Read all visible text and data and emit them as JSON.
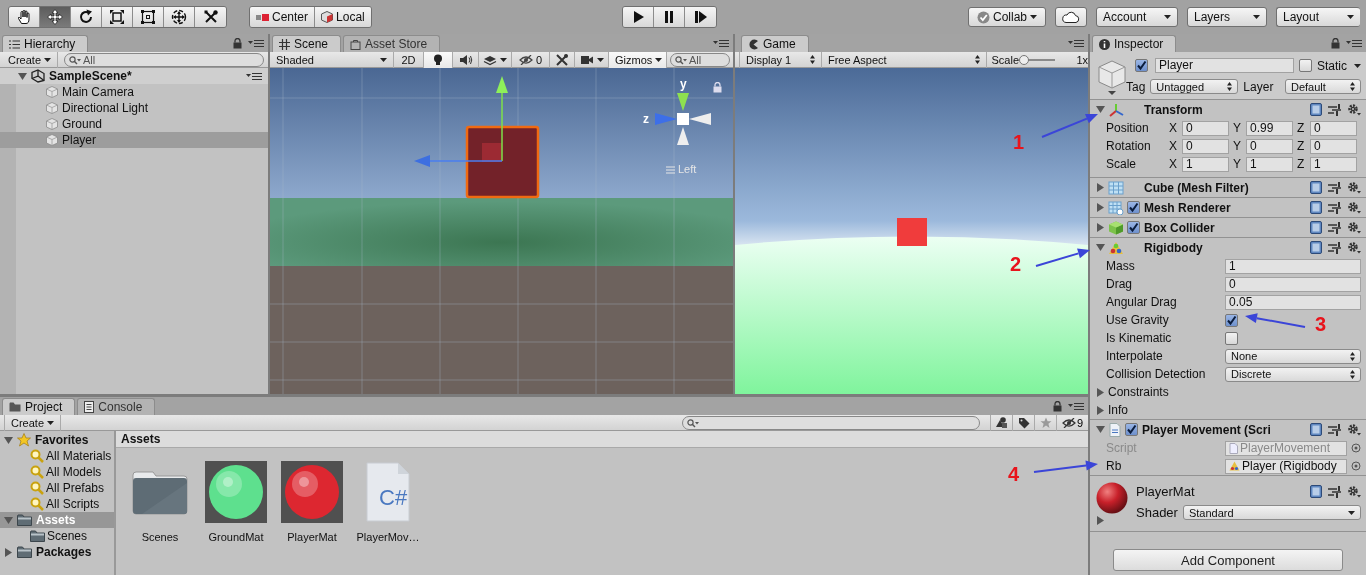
{
  "toolbar": {
    "tools": [
      {
        "kind": "hand",
        "selected": false
      },
      {
        "kind": "move",
        "selected": true
      },
      {
        "kind": "rotate",
        "selected": false
      },
      {
        "kind": "scale",
        "selected": false
      },
      {
        "kind": "rect",
        "selected": false
      },
      {
        "kind": "transform",
        "selected": false
      },
      {
        "kind": "custom",
        "selected": false
      }
    ],
    "pivot": [
      {
        "kind": "center",
        "label": "Center"
      },
      {
        "kind": "local",
        "label": "Local"
      }
    ],
    "playback": [
      {
        "kind": "play"
      },
      {
        "kind": "pause"
      },
      {
        "kind": "step"
      }
    ],
    "collab": "Collab",
    "account": "Account",
    "layers": "Layers",
    "layout": "Layout"
  },
  "hierarchy": {
    "tab": "Hierarchy",
    "create": "Create",
    "search_placeholder": "All",
    "scene": {
      "name": "SampleScene*",
      "expanded": true,
      "children": [
        {
          "name": "Main Camera",
          "selected": false
        },
        {
          "name": "Directional Light",
          "selected": false
        },
        {
          "name": "Ground",
          "selected": false
        },
        {
          "name": "Player",
          "selected": true
        }
      ]
    }
  },
  "scene_view": {
    "tabs": [
      {
        "label": "Scene",
        "selected": true
      },
      {
        "label": "Asset Store",
        "selected": false
      }
    ],
    "shading": "Shaded",
    "mode_2d": "2D",
    "hidden_count": "0",
    "gizmos": "Gizmos",
    "search_placeholder": "All",
    "axis_y": "y",
    "axis_z": "z",
    "view_name": "Left"
  },
  "game_view": {
    "tab": "Game",
    "display": "Display 1",
    "aspect": "Free Aspect",
    "scale_label": "Scale",
    "scale_slider": {
      "level": 0
    },
    "scale_value": "1x"
  },
  "inspector": {
    "tab": "Inspector",
    "object": {
      "active": true,
      "name": "Player",
      "static": false,
      "static_label": "Static",
      "tag_label": "Tag",
      "tag": "Untagged",
      "layer_label": "Layer",
      "layer": "Default"
    },
    "components": [
      {
        "kind": "transform",
        "title": "Transform",
        "expanded": true,
        "rows": [
          {
            "label": "Position",
            "values": [
              {
                "axis": "X",
                "value": "0"
              },
              {
                "axis": "Y",
                "value": "0.99"
              },
              {
                "axis": "Z",
                "value": "0"
              }
            ]
          },
          {
            "label": "Rotation",
            "values": [
              {
                "axis": "X",
                "value": "0"
              },
              {
                "axis": "Y",
                "value": "0"
              },
              {
                "axis": "Z",
                "value": "0"
              }
            ]
          },
          {
            "label": "Scale",
            "values": [
              {
                "axis": "X",
                "value": "1"
              },
              {
                "axis": "Y",
                "value": "1"
              },
              {
                "axis": "Z",
                "value": "1"
              }
            ]
          }
        ]
      },
      {
        "kind": "component",
        "title": "Cube (Mesh Filter)",
        "expanded": false
      },
      {
        "kind": "component",
        "title": "Mesh Renderer",
        "expanded": false,
        "enabled": true
      },
      {
        "kind": "component",
        "title": "Box Collider",
        "expanded": false,
        "enabled": true
      },
      {
        "kind": "component",
        "title": "Rigidbody",
        "expanded": true,
        "properties": [
          {
            "kind": "number",
            "label": "Mass",
            "value": "1"
          },
          {
            "kind": "number",
            "label": "Drag",
            "value": "0"
          },
          {
            "kind": "number",
            "label": "Angular Drag",
            "value": "0.05"
          },
          {
            "kind": "checkbox",
            "label": "Use Gravity",
            "checked": true
          },
          {
            "kind": "checkbox",
            "label": "Is Kinematic",
            "checked": false
          },
          {
            "kind": "dropdown",
            "label": "Interpolate",
            "value": "None"
          },
          {
            "kind": "dropdown",
            "label": "Collision Detection",
            "value": "Discrete"
          },
          {
            "kind": "foldout",
            "label": "Constraints",
            "expanded": false
          },
          {
            "kind": "foldout",
            "label": "Info",
            "expanded": false
          }
        ]
      },
      {
        "kind": "component",
        "title": "Player Movement (Scri",
        "expanded": true,
        "enabled": true,
        "properties": [
          {
            "kind": "object",
            "label": "Script",
            "value": "PlayerMovement",
            "disabled": true
          },
          {
            "kind": "object",
            "label": "Rb",
            "value": "Player (Rigidbody",
            "disabled": false
          }
        ]
      },
      {
        "kind": "material",
        "title": "PlayerMat",
        "expanded": false,
        "shader_label": "Shader",
        "shader": "Standard"
      }
    ],
    "add_component": "Add Component"
  },
  "project": {
    "tabs": [
      {
        "label": "Project",
        "selected": true
      },
      {
        "label": "Console",
        "selected": false
      }
    ],
    "create": "Create",
    "hidden_count": "9",
    "tree": [
      {
        "kind": "favorites",
        "label": "Favorites",
        "expanded": true,
        "selected": false,
        "children": [
          {
            "label": "All Materials",
            "selected": false
          },
          {
            "label": "All Models",
            "selected": false
          },
          {
            "label": "All Prefabs",
            "selected": false
          },
          {
            "label": "All Scripts",
            "selected": false
          }
        ]
      },
      {
        "kind": "folder",
        "label": "Assets",
        "expanded": true,
        "selected": true,
        "children": [
          {
            "label": "Scenes",
            "selected": false
          }
        ]
      },
      {
        "kind": "folder",
        "label": "Packages",
        "expanded": false,
        "selected": false
      }
    ],
    "path": "Assets",
    "assets": [
      {
        "kind": "folder",
        "name": "Scenes"
      },
      {
        "kind": "material",
        "name": "GroundMat",
        "color": "#5ee08e"
      },
      {
        "kind": "material",
        "name": "PlayerMat",
        "color": "#dd2730"
      },
      {
        "kind": "script",
        "name": "PlayerMov…",
        "icon_label": "C#"
      }
    ]
  },
  "annotations": [
    {
      "label": "1"
    },
    {
      "label": "2"
    },
    {
      "label": "3"
    },
    {
      "label": "4"
    }
  ]
}
